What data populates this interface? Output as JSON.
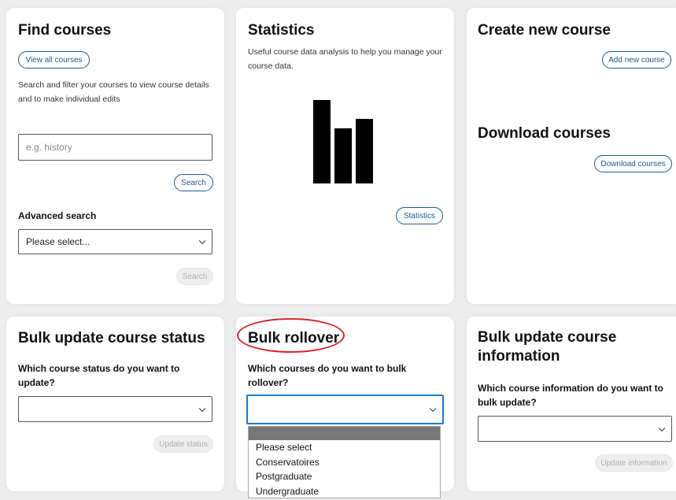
{
  "find": {
    "title": "Find courses",
    "view_all_label": "View all courses",
    "description": "Search and filter your courses to view course details and to make individual edits",
    "search_placeholder": "e.g. history",
    "search_label": "Search",
    "advanced_label": "Advanced search",
    "advanced_value": "Please select...",
    "advanced_search_label": "Search"
  },
  "stats": {
    "title": "Statistics",
    "description": "Useful course data analysis to help you manage your course data.",
    "icon": "bar-chart-icon",
    "button_label": "Statistics"
  },
  "create": {
    "title": "Create new course",
    "button_label": "Add new course"
  },
  "download": {
    "title": "Download courses",
    "button_label": "Download courses"
  },
  "status": {
    "title": "Bulk update course status",
    "question": "Which course status do you want to update?",
    "select_value": "",
    "button_label": "Update status"
  },
  "rollover": {
    "title": "Bulk rollover",
    "question": "Which courses do you want to bulk rollover?",
    "select_value": "",
    "options": [
      "Please select",
      "Conservatoires",
      "Postgraduate",
      "Undergraduate"
    ]
  },
  "info": {
    "title": "Bulk update course information",
    "question": "Which course information do you want to bulk update?",
    "select_value": "",
    "button_label": "Update information"
  },
  "colors": {
    "accent": "#1d5a91",
    "focus": "#1c7ccb",
    "annotation": "#d9232a",
    "background": "#ededed"
  }
}
